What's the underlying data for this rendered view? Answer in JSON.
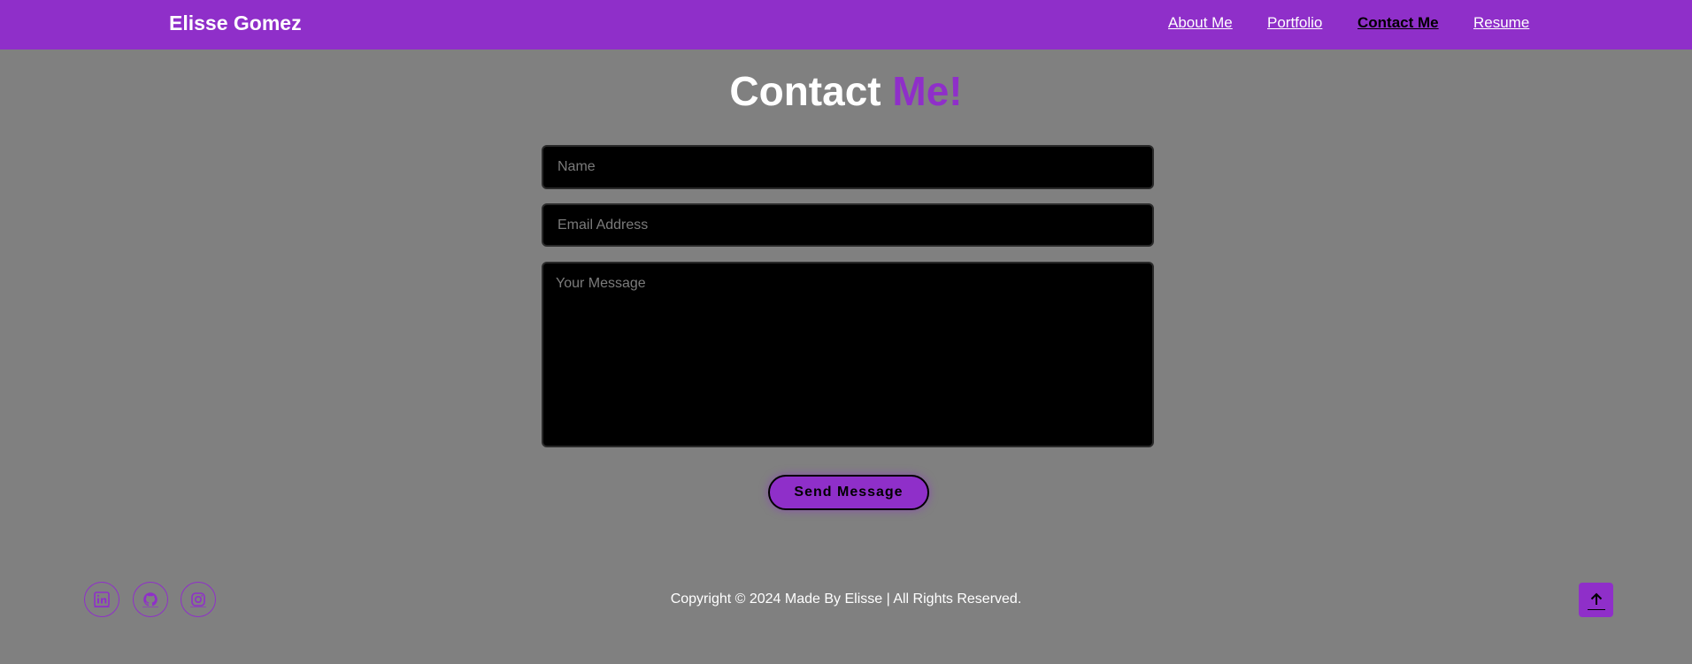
{
  "header": {
    "brand": "Elisse Gomez",
    "nav": [
      {
        "label": "About Me",
        "active": false
      },
      {
        "label": "Portfolio",
        "active": false
      },
      {
        "label": "Contact Me",
        "active": true
      },
      {
        "label": "Resume",
        "active": false
      }
    ]
  },
  "main": {
    "title_part1": "Contact ",
    "title_part2": "Me!",
    "form": {
      "name_placeholder": "Name",
      "name_value": "",
      "email_placeholder": "Email Address",
      "email_value": "",
      "message_placeholder": "Your Message",
      "message_value": "",
      "submit_label": "Send Message"
    }
  },
  "footer": {
    "social_icons": [
      "linkedin-icon",
      "github-icon",
      "instagram-icon"
    ],
    "copyright": "Copyright © 2024 Made By Elisse | All Rights Reserved."
  },
  "colors": {
    "accent": "#8f2fc9",
    "background": "#808080",
    "field_background": "#000000"
  }
}
